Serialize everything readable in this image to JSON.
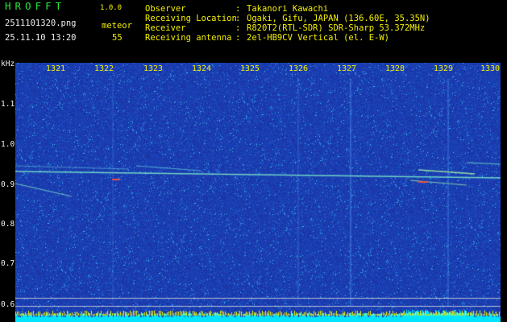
{
  "app": {
    "logo": "HROFFT",
    "version": "1.0.0"
  },
  "file": {
    "name": "2511101320.png",
    "datetime": "25.11.10 13:20"
  },
  "detection": {
    "label": "meteor",
    "count": "55"
  },
  "info": [
    {
      "key": "Observer",
      "sep": ":",
      "value": "Takanori Kawachi"
    },
    {
      "key": "Receiving Location",
      "sep": ":",
      "value": "Ogaki, Gifu, JAPAN (136.60E, 35.35N)"
    },
    {
      "key": "Receiver",
      "sep": ":",
      "value": "R820T2(RTL-SDR) SDR-Sharp 53.372MHz"
    },
    {
      "key": "Receiving antenna",
      "sep": ":",
      "value": "2el-HB9CV Vertical (el. E-W)"
    }
  ],
  "yaxis": {
    "unit": "kHz",
    "ticks": [
      "1.1",
      "1.0",
      "0.9",
      "0.8",
      "0.7",
      "0.6"
    ]
  },
  "xaxis": {
    "ticks": [
      "1321",
      "1322",
      "1323",
      "1324",
      "1325",
      "1326",
      "1327",
      "1328",
      "1329",
      "1330"
    ]
  },
  "colors": {
    "header_text": "#26e83a",
    "accent": "#f4f000",
    "label": "#f0f0f0",
    "background": "#1a2f9e",
    "noise_floor": "#00e5ff"
  }
}
